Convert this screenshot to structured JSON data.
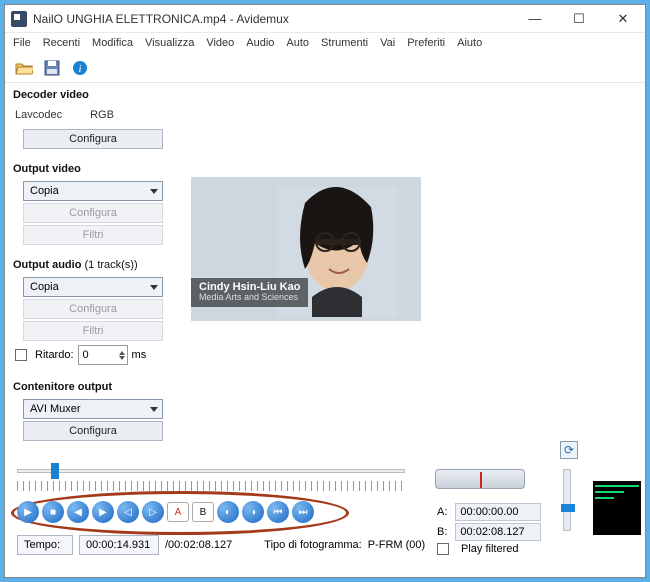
{
  "window": {
    "title": "NailO UNGHIA ELETTRONICA.mp4 - Avidemux"
  },
  "menu": {
    "file": "File",
    "recenti": "Recenti",
    "modifica": "Modifica",
    "visualizza": "Visualizza",
    "video": "Video",
    "audio": "Audio",
    "auto": "Auto",
    "strumenti": "Strumenti",
    "vai": "Vai",
    "preferiti": "Preferiti",
    "aiuto": "Aiuto"
  },
  "decoder": {
    "heading": "Decoder video",
    "lib": "Lavcodec",
    "cs": "RGB",
    "config": "Configura"
  },
  "outvideo": {
    "heading": "Output video",
    "selected": "Copia",
    "config": "Configura",
    "filters": "Filtri"
  },
  "outaudio": {
    "heading": "Output audio",
    "tracks": "(1 track(s))",
    "selected": "Copia",
    "config": "Configura",
    "filters": "Filtri",
    "delay_label": "Ritardo:",
    "delay_value": "0",
    "delay_unit": "ms"
  },
  "container": {
    "heading": "Contenitore output",
    "selected": "AVI Muxer",
    "config": "Configura"
  },
  "preview": {
    "name": "Cindy Hsin-Liu Kao",
    "dept": "Media Arts and Sciences"
  },
  "tempo": {
    "label": "Tempo:",
    "current": "00:00:14.931",
    "total": "/00:02:08.127",
    "frametype_label": "Tipo di fotogramma:",
    "frametype": "P-FRM (00)"
  },
  "ab": {
    "a_label": "A:",
    "a_val": "00:00:00.00",
    "b_label": "B:",
    "b_val": "00:02:08.127",
    "playfiltered": "Play filtered"
  }
}
